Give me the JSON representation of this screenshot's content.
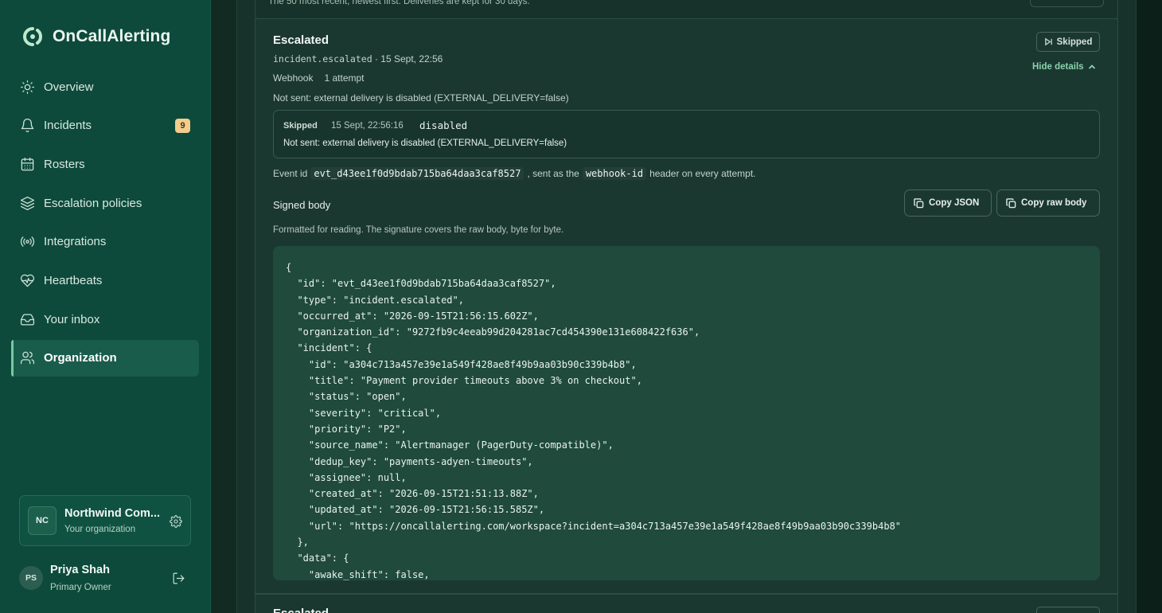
{
  "brand": {
    "name": "OnCallAlerting",
    "logo_icon": "oncall-logo-icon"
  },
  "sidebar": {
    "items": [
      {
        "label": "Overview",
        "icon": "sun-icon",
        "active": false
      },
      {
        "label": "Incidents",
        "icon": "bell-icon",
        "active": false,
        "badge": "9"
      },
      {
        "label": "Rosters",
        "icon": "calendar-icon",
        "active": false
      },
      {
        "label": "Escalation policies",
        "icon": "layers-icon",
        "active": false
      },
      {
        "label": "Integrations",
        "icon": "broadcast-icon",
        "active": false
      },
      {
        "label": "Heartbeats",
        "icon": "heart-pulse-icon",
        "active": false
      },
      {
        "label": "Your inbox",
        "icon": "inbox-icon",
        "active": false
      },
      {
        "label": "Organization",
        "icon": "users-icon",
        "active": true
      }
    ],
    "org": {
      "initials": "NC",
      "name": "Northwind Com...",
      "subtitle": "Your organization"
    },
    "user": {
      "initials": "PS",
      "name": "Priya Shah",
      "role": "Primary Owner"
    }
  },
  "previous": {
    "note": "The 50 most recent, newest first. Deliveries are kept for 30 days."
  },
  "delivery": {
    "title": "Escalated",
    "event_type": "incident.escalated",
    "timestamp": " · 15 Sept, 22:56",
    "channel": "Webhook",
    "attempts": "1 attempt",
    "status": "Skipped",
    "toggle_label": "Hide details",
    "reason": "Not sent: external delivery is disabled (EXTERNAL_DELIVERY=false)",
    "attempt": {
      "status": "Skipped",
      "time": "15 Sept, 22:56:16",
      "code": "disabled",
      "message": "Not sent: external delivery is disabled (EXTERNAL_DELIVERY=false)"
    },
    "event_id_prefix": "Event id",
    "event_id": "evt_d43ee1f0d9bdab715ba64daa3caf8527",
    "event_id_mid": ", sent as the",
    "header_name": "webhook-id",
    "event_id_suffix": "header on every attempt.",
    "signed_body_label": "Signed body",
    "copy_json_label": "Copy JSON",
    "copy_raw_label": "Copy raw body",
    "format_note": "Formatted for reading. The signature covers the raw body, byte for byte.",
    "body": "{\n  \"id\": \"evt_d43ee1f0d9bdab715ba64daa3caf8527\",\n  \"type\": \"incident.escalated\",\n  \"occurred_at\": \"2026-09-15T21:56:15.602Z\",\n  \"organization_id\": \"9272fb9c4eeab99d204281ac7cd454390e131e608422f636\",\n  \"incident\": {\n    \"id\": \"a304c713a457e39e1a549f428ae8f49b9aa03b90c339b4b8\",\n    \"title\": \"Payment provider timeouts above 3% on checkout\",\n    \"status\": \"open\",\n    \"severity\": \"critical\",\n    \"priority\": \"P2\",\n    \"source_name\": \"Alertmanager (PagerDuty-compatible)\",\n    \"dedup_key\": \"payments-adyen-timeouts\",\n    \"assignee\": null,\n    \"created_at\": \"2026-09-15T21:51:13.88Z\",\n    \"updated_at\": \"2026-09-15T21:56:15.585Z\",\n    \"url\": \"https://oncallalerting.com/workspace?incident=a304c713a457e39e1a549f428ae8f49b9aa03b90c339b4b8\"\n  },\n  \"data\": {\n    \"awake_shift\": false,"
  },
  "next": {
    "title": "Escalated"
  },
  "colors": {
    "sidebar": "#0d4a3b",
    "accent": "#89d3ad",
    "badge": "#f2cd8c",
    "code_bg": "#1f4a3c"
  }
}
